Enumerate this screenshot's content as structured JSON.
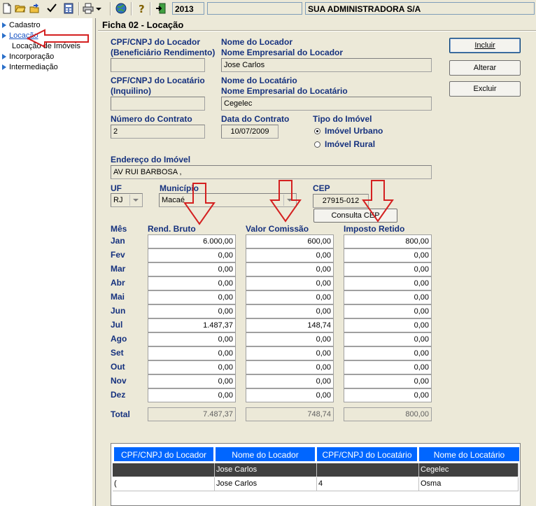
{
  "toolbar": {
    "year": "2013",
    "blank_field": "",
    "company": "SUA ADMINISTRADORA S/A",
    "icons": [
      "new-file-icon",
      "open-folder-icon",
      "export-icon",
      "check-icon",
      "calculator-icon",
      "print-icon",
      "dropdown-arrow-icon",
      "globe-icon",
      "help-icon",
      "exit-icon"
    ]
  },
  "tree": {
    "items": [
      {
        "label": "Cadastro"
      },
      {
        "label": "Locação"
      },
      {
        "label": "Locação de Imóveis"
      },
      {
        "label": "Incorporação"
      },
      {
        "label": "Intermediação"
      }
    ]
  },
  "form": {
    "title": "Ficha 02 - Locação",
    "locador_cpf_label1": "CPF/CNPJ do Locador",
    "locador_cpf_label2": "(Beneficiário Rendimento)",
    "locador_cpf_value": "",
    "locador_nome_label1": "Nome do Locador",
    "locador_nome_label2": "Nome Empresarial do Locador",
    "locador_nome_value": "Jose Carlos",
    "locatario_cpf_label1": "CPF/CNPJ do Locatário",
    "locatario_cpf_label2": "(Inquilino)",
    "locatario_cpf_value": "",
    "locatario_nome_label1": "Nome do Locatário",
    "locatario_nome_label2": "Nome Empresarial do Locatário",
    "locatario_nome_value": "Cegelec",
    "contrato_label": "Número do Contrato",
    "contrato_value": "2",
    "data_label": "Data do Contrato",
    "data_value": "10/07/2009",
    "tipo_label": "Tipo do Imóvel",
    "tipo_urbano": "Imóvel Urbano",
    "tipo_rural": "Imóvel Rural",
    "endereco_label": "Endereço do Imóvel",
    "endereco_value": "AV  RUI BARBOSA ,",
    "uf_label": "UF",
    "uf_value": "RJ",
    "municipio_label": "Município",
    "municipio_value": "Macaé",
    "cep_label": "CEP",
    "cep_value": "27915-012",
    "consulta_cep": "Consulta CEP"
  },
  "buttons": {
    "incluir": "Incluir",
    "alterar": "Alterar",
    "excluir": "Excluir"
  },
  "values_table": {
    "mes_label": "Mês",
    "col1": "Rend. Bruto",
    "col2": "Valor Comissão",
    "col3": "Imposto Retido",
    "months": [
      {
        "m": "Jan",
        "a": "6.000,00",
        "b": "600,00",
        "c": "800,00"
      },
      {
        "m": "Fev",
        "a": "0,00",
        "b": "0,00",
        "c": "0,00"
      },
      {
        "m": "Mar",
        "a": "0,00",
        "b": "0,00",
        "c": "0,00"
      },
      {
        "m": "Abr",
        "a": "0,00",
        "b": "0,00",
        "c": "0,00"
      },
      {
        "m": "Mai",
        "a": "0,00",
        "b": "0,00",
        "c": "0,00"
      },
      {
        "m": "Jun",
        "a": "0,00",
        "b": "0,00",
        "c": "0,00"
      },
      {
        "m": "Jul",
        "a": "1.487,37",
        "b": "148,74",
        "c": "0,00"
      },
      {
        "m": "Ago",
        "a": "0,00",
        "b": "0,00",
        "c": "0,00"
      },
      {
        "m": "Set",
        "a": "0,00",
        "b": "0,00",
        "c": "0,00"
      },
      {
        "m": "Out",
        "a": "0,00",
        "b": "0,00",
        "c": "0,00"
      },
      {
        "m": "Nov",
        "a": "0,00",
        "b": "0,00",
        "c": "0,00"
      },
      {
        "m": "Dez",
        "a": "0,00",
        "b": "0,00",
        "c": "0,00"
      }
    ],
    "total_label": "Total",
    "total_a": "7.487,37",
    "total_b": "748,74",
    "total_c": "800,00"
  },
  "grid": {
    "headers": [
      "CPF/CNPJ do Locador",
      "Nome do Locador",
      "CPF/CNPJ do Locatário",
      "Nome do Locatário"
    ],
    "rows": [
      {
        "c1": "",
        "c2": "Jose Carlos",
        "c3": "",
        "c4": "Cegelec",
        "selected": true
      },
      {
        "c1": "(",
        "c2": "Jose Carlos",
        "c3": "4",
        "c4": "Osma",
        "selected": false
      }
    ]
  },
  "colors": {
    "annotation_arrow": "#d42020",
    "label_blue": "#15317e",
    "grid_header": "#0066ff",
    "selected_row": "#404040"
  }
}
